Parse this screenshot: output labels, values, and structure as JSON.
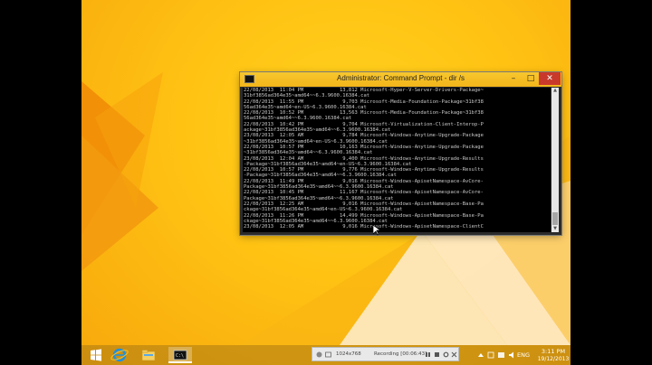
{
  "window": {
    "title": "Administrator: Command Prompt - dir  /s",
    "minimize": "–",
    "maximize": "□",
    "close": "✕"
  },
  "console_lines": [
    "22/08/2013  11:04 PM            13,812 Microsoft-Hyper-V-Server-Drivers-Package~",
    "31bf3856ad364e35~amd64~~6.3.9600.16384.cat",
    "22/08/2013  11:55 PM             9,703 Microsoft-Media-Foundation-Package~31bf38",
    "56ad364e35~amd64~en-US~6.3.9600.16384.cat",
    "22/08/2013  10:52 PM            13,563 Microsoft-Media-Foundation-Package~31bf38",
    "56ad364e35~amd64~~6.3.9600.16384.cat",
    "22/08/2013  10:42 PM             9,704 Microsoft-Virtualization-Client-Interop-P",
    "ackage~31bf3856ad364e35~amd64~~6.3.9600.16384.cat",
    "23/08/2013  12:05 AM             9,784 Microsoft-Windows-Anytime-Upgrade-Package",
    "~31bf3856ad364e35~amd64~en-US~6.3.9600.16384.cat",
    "22/08/2013  10:57 PM            10,163 Microsoft-Windows-Anytime-Upgrade-Package",
    "~31bf3856ad364e35~amd64~~6.3.9600.16384.cat",
    "23/08/2013  12:04 AM             9,400 Microsoft-Windows-Anytime-Upgrade-Results",
    "-Package~31bf3856ad364e35~amd64~en-US~6.3.9600.16384.cat",
    "22/08/2013  10:57 PM             9,776 Microsoft-Windows-Anytime-Upgrade-Results",
    "-Package~31bf3856ad364e35~amd64~~6.3.9600.16384.cat",
    "22/08/2013  11:49 PM             9,016 Microsoft-Windows-ApisetNamespace-AvCore-",
    "Package~31bf3856ad364e35~amd64~~6.3.9600.16384.cat",
    "22/08/2013  10:45 PM            11,167 Microsoft-Windows-ApisetNamespace-AvCore-",
    "Package~31bf3856ad364e35~amd64~~6.3.9600.16384.cat",
    "22/08/2013  12:25 AM             9,016 Microsoft-Windows-ApisetNamespace-Base-Pa",
    "ckage~31bf3856ad364e35~amd64~en-US~6.3.9600.16384.cat",
    "22/08/2013  11:26 PM            14,499 Microsoft-Windows-ApisetNamespace-Base-Pa",
    "ckage~31bf3856ad364e35~amd64~~6.3.9600.16384.cat",
    "23/08/2013  12:05 AM             9,016 Microsoft-Windows-ApisetNamespace-ClientC"
  ],
  "taskbar": {
    "start": "start-icon",
    "ie": "internet-explorer-icon",
    "explorer": "file-explorer-icon",
    "cmd": "command-prompt-icon"
  },
  "recorder": {
    "size": "1024x768",
    "status": "Recording [00:06:43]"
  },
  "tray": {
    "language": "ENG",
    "time": "3:11 PM",
    "date": "19/12/2013"
  },
  "colors": {
    "desktop": "#ffc213",
    "console_bg": "#000000",
    "console_text": "#c8c8c8",
    "close_button": "#c8392b"
  }
}
